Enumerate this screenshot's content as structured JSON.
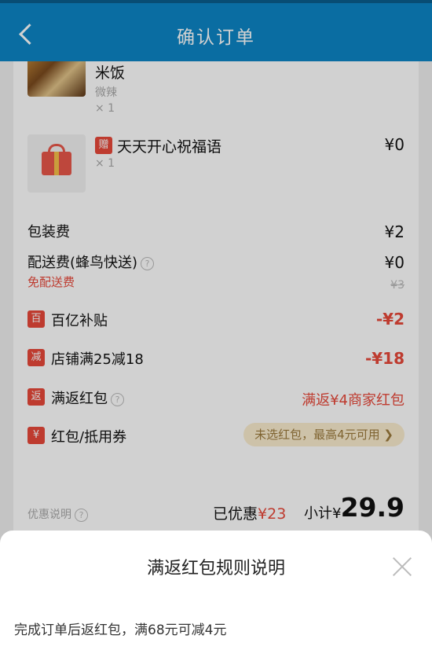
{
  "header": {
    "title": "确认订单"
  },
  "items": [
    {
      "name": "米饭",
      "spec": "微辣",
      "qty": "× 1"
    },
    {
      "tag": "赠",
      "name": "天天开心祝福语",
      "qty": "× 1",
      "price": "¥0"
    }
  ],
  "fees": {
    "packing_label": "包装费",
    "packing_price": "¥2",
    "delivery_label": "配送费(蜂鸟快送)",
    "delivery_price": "¥0",
    "free_delivery": "免配送费",
    "original_delivery": "¥3"
  },
  "promos": [
    {
      "icon": "百",
      "label": "百亿补贴",
      "value": "-¥2"
    },
    {
      "icon": "减",
      "label": "店铺满25减18",
      "value": "-¥18"
    },
    {
      "icon": "返",
      "label": "满返红包",
      "value": "满返¥4商家红包"
    },
    {
      "icon": "¥",
      "label": "红包/抵用券",
      "value": "未选红包，最高4元可用 ❯"
    }
  ],
  "summary": {
    "note": "优惠说明",
    "saved_label": "已优惠",
    "saved_value": "¥23",
    "subtotal_label": "小计¥",
    "subtotal_value": "29.9"
  },
  "sheet": {
    "title": "满返红包规则说明",
    "body": "完成订单后返红包，满68元可减4元"
  },
  "colors": {
    "header": "#0d86c6",
    "accent": "#e8483a",
    "pill_bg": "#fbedcf"
  }
}
